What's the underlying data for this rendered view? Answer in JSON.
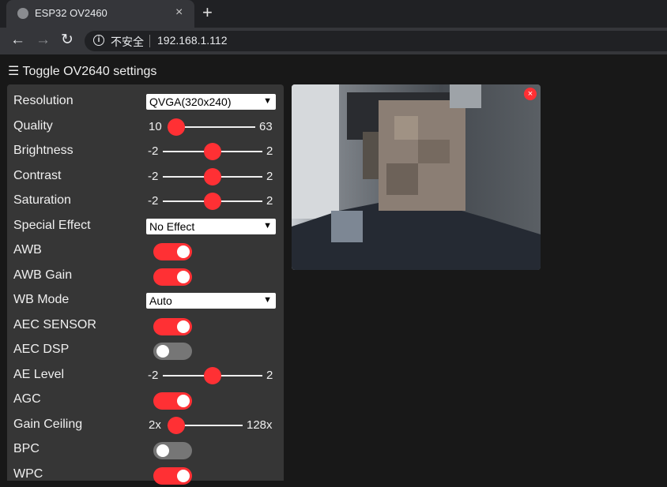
{
  "browser": {
    "tab_title": "ESP32 OV2460",
    "tab_close": "×",
    "new_tab": "+",
    "security_label": "不安全",
    "url": "192.168.1.112"
  },
  "page": {
    "toggle_label": "Toggle OV2640 settings"
  },
  "controls": [
    {
      "label": "Resolution",
      "type": "select",
      "value": "QVGA(320x240)"
    },
    {
      "label": "Quality",
      "type": "range",
      "min": "10",
      "max": "63",
      "value": 10
    },
    {
      "label": "Brightness",
      "type": "range",
      "min": "-2",
      "max": "2",
      "value": 0
    },
    {
      "label": "Contrast",
      "type": "range",
      "min": "-2",
      "max": "2",
      "value": 0
    },
    {
      "label": "Saturation",
      "type": "range",
      "min": "-2",
      "max": "2",
      "value": 0
    },
    {
      "label": "Special Effect",
      "type": "select",
      "value": "No Effect"
    },
    {
      "label": "AWB",
      "type": "switch",
      "on": true
    },
    {
      "label": "AWB Gain",
      "type": "switch",
      "on": true
    },
    {
      "label": "WB Mode",
      "type": "select",
      "value": "Auto"
    },
    {
      "label": "AEC SENSOR",
      "type": "switch",
      "on": true
    },
    {
      "label": "AEC DSP",
      "type": "switch",
      "on": false
    },
    {
      "label": "AE Level",
      "type": "range",
      "min": "-2",
      "max": "2",
      "value": 0
    },
    {
      "label": "AGC",
      "type": "switch",
      "on": true
    },
    {
      "label": "Gain Ceiling",
      "type": "range",
      "min": "2x",
      "max": "128x",
      "value": 0
    },
    {
      "label": "BPC",
      "type": "switch",
      "on": false
    },
    {
      "label": "WPC",
      "type": "switch",
      "on": true
    }
  ],
  "stream": {
    "close_label": "×"
  },
  "colors": {
    "accent": "#ff3034",
    "panel": "#363636",
    "background": "#181818"
  }
}
